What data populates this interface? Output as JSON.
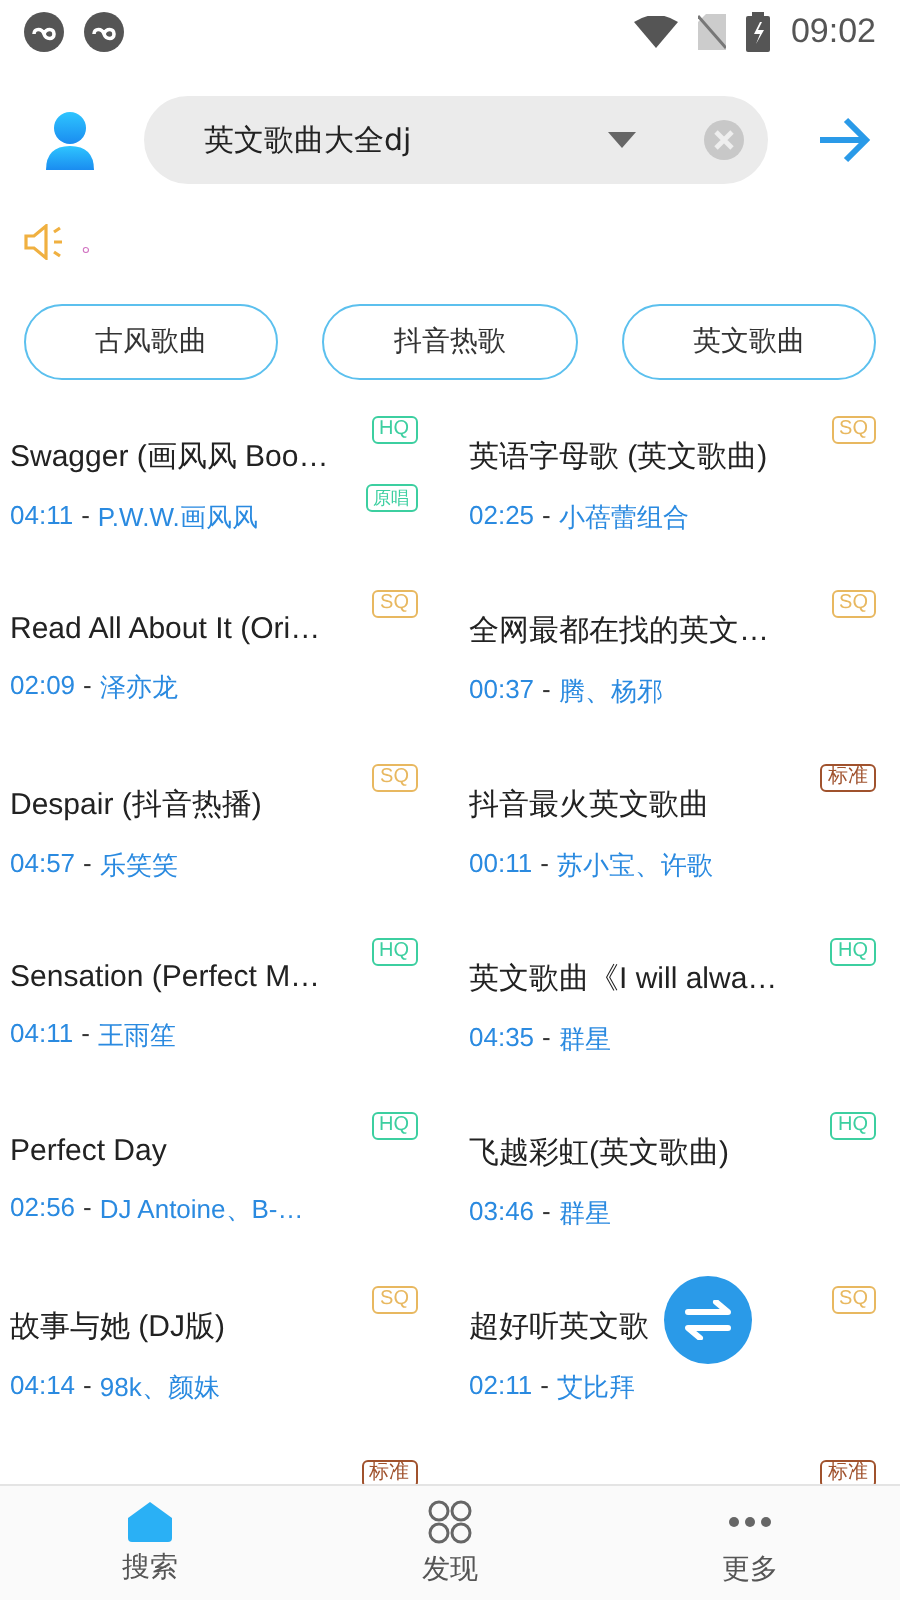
{
  "status_bar": {
    "time": "09:02"
  },
  "search": {
    "value": "英文歌曲大全dj"
  },
  "notice": {
    "text": "。"
  },
  "quick_tags": [
    {
      "label": "古风歌曲"
    },
    {
      "label": "抖音热歌"
    },
    {
      "label": "英文歌曲"
    }
  ],
  "songs": [
    {
      "title": "Swagger (画风风 Boo…",
      "duration": "04:11",
      "artist": "P.W.W.画风风",
      "badge": {
        "kind": "hq",
        "text": "HQ"
      },
      "original_badge": "原唱"
    },
    {
      "title": "英语字母歌 (英文歌曲)",
      "duration": "02:25",
      "artist": "小蓓蕾组合",
      "badge": {
        "kind": "sq",
        "text": "SQ"
      }
    },
    {
      "title": "Read All About It (Ori…",
      "duration": "02:09",
      "artist": "泽亦龙",
      "badge": {
        "kind": "sq",
        "text": "SQ"
      }
    },
    {
      "title": "全网最都在找的英文…",
      "duration": "00:37",
      "artist": "腾、杨邪",
      "badge": {
        "kind": "sq",
        "text": "SQ"
      }
    },
    {
      "title": "Despair (抖音热播)",
      "duration": "04:57",
      "artist": "乐笑笑",
      "badge": {
        "kind": "sq",
        "text": "SQ"
      }
    },
    {
      "title": "抖音最火英文歌曲",
      "duration": "00:11",
      "artist": "苏小宝、许歌",
      "badge": {
        "kind": "std",
        "text": "标准"
      }
    },
    {
      "title": "Sensation (Perfect M…",
      "duration": "04:11",
      "artist": "王雨笙",
      "badge": {
        "kind": "hq",
        "text": "HQ"
      }
    },
    {
      "title": "英文歌曲《I will alwa…",
      "duration": "04:35",
      "artist": "群星",
      "badge": {
        "kind": "hq",
        "text": "HQ"
      }
    },
    {
      "title": "Perfect Day",
      "duration": "02:56",
      "artist": "DJ Antoine、B-…",
      "badge": {
        "kind": "hq",
        "text": "HQ"
      }
    },
    {
      "title": "飞越彩虹(英文歌曲)",
      "duration": "03:46",
      "artist": "群星",
      "badge": {
        "kind": "hq",
        "text": "HQ"
      }
    },
    {
      "title": "故事与她 (DJ版)",
      "duration": "04:14",
      "artist": "98k、颜妹",
      "badge": {
        "kind": "sq",
        "text": "SQ"
      }
    },
    {
      "title": "超好听英文歌",
      "duration": "02:11",
      "artist": "艾比拜",
      "badge": {
        "kind": "sq",
        "text": "SQ"
      }
    },
    {
      "badge": {
        "kind": "std",
        "text": "标准"
      }
    },
    {
      "badge": {
        "kind": "std",
        "text": "标准"
      }
    }
  ],
  "separator": "-",
  "bottom_nav": [
    {
      "label": "搜索",
      "kind": "home",
      "selected": true
    },
    {
      "label": "发现",
      "kind": "grid",
      "selected": false
    },
    {
      "label": "更多",
      "kind": "more",
      "selected": false
    }
  ]
}
